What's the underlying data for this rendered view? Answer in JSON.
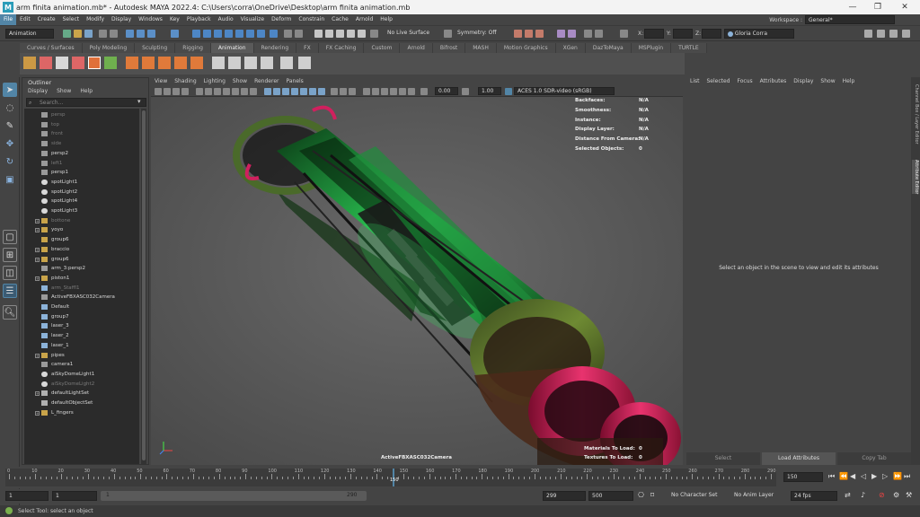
{
  "window": {
    "title": "arm finita animation.mb* - Autodesk MAYA 2022.4: C:\\Users\\corra\\OneDrive\\Desktop\\arm finita animation.mb",
    "logo": "M",
    "minimize": "—",
    "maximize": "❐",
    "close": "✕"
  },
  "menu": [
    "File",
    "Edit",
    "Create",
    "Select",
    "Modify",
    "Display",
    "Windows",
    "Key",
    "Playback",
    "Audio",
    "Visualize",
    "Deform",
    "Constrain",
    "Cache",
    "Arnold",
    "Help"
  ],
  "workspace": {
    "label": "Workspace :",
    "value": "General*"
  },
  "statusline": {
    "menuset": "Animation",
    "live_surface": "No Live Surface",
    "symmetry": "Symmetry: Off",
    "x_label": "X:",
    "y_label": "Y:",
    "z_label": "Z:",
    "user": "Gloria Corra"
  },
  "shelf_tabs": [
    "Curves / Surfaces",
    "Poly Modeling",
    "Sculpting",
    "Rigging",
    "Animation",
    "Rendering",
    "FX",
    "FX Caching",
    "Custom",
    "Arnold",
    "Bifrost",
    "MASH",
    "Motion Graphics",
    "XGen",
    "DazToMaya",
    "MSPlugin",
    "TURTLE"
  ],
  "shelf_active": "Animation",
  "outliner": {
    "title": "Outliner",
    "menu": [
      "Display",
      "Show",
      "Help"
    ],
    "search_placeholder": "Search...",
    "items": [
      {
        "label": "persp",
        "type": "camera",
        "dim": true,
        "exp": false
      },
      {
        "label": "top",
        "type": "camera",
        "dim": true,
        "exp": false
      },
      {
        "label": "front",
        "type": "camera",
        "dim": true,
        "exp": false
      },
      {
        "label": "side",
        "type": "camera",
        "dim": true,
        "exp": false
      },
      {
        "label": "persp2",
        "type": "camera",
        "dim": false,
        "exp": false
      },
      {
        "label": "left1",
        "type": "camera",
        "dim": true,
        "exp": false
      },
      {
        "label": "persp1",
        "type": "camera",
        "dim": false,
        "exp": false
      },
      {
        "label": "spotLight1",
        "type": "light",
        "dim": false,
        "exp": false
      },
      {
        "label": "spotLight2",
        "type": "light",
        "dim": false,
        "exp": false
      },
      {
        "label": "spotLight4",
        "type": "light",
        "dim": false,
        "exp": false
      },
      {
        "label": "spotLight3",
        "type": "light",
        "dim": false,
        "exp": false
      },
      {
        "label": "bottone",
        "type": "group",
        "dim": true,
        "exp": true
      },
      {
        "label": "yoyo",
        "type": "group",
        "dim": false,
        "exp": true
      },
      {
        "label": "group6",
        "type": "group",
        "dim": false,
        "exp": false
      },
      {
        "label": "braccio",
        "type": "group",
        "dim": false,
        "exp": true
      },
      {
        "label": "group6",
        "type": "group",
        "dim": false,
        "exp": true
      },
      {
        "label": "arm_3:persp2",
        "type": "camera",
        "dim": false,
        "exp": false
      },
      {
        "label": "piston1",
        "type": "group",
        "dim": false,
        "exp": true
      },
      {
        "label": "arm_Staffl1",
        "type": "mesh",
        "dim": true,
        "exp": false
      },
      {
        "label": "ActiveFBXASC032Camera",
        "type": "camera",
        "dim": false,
        "exp": false
      },
      {
        "label": "Default",
        "type": "mesh",
        "dim": false,
        "exp": false
      },
      {
        "label": "group7",
        "type": "mesh",
        "dim": false,
        "exp": false
      },
      {
        "label": "laser_3",
        "type": "mesh",
        "dim": false,
        "exp": false
      },
      {
        "label": "laser_2",
        "type": "mesh",
        "dim": false,
        "exp": false
      },
      {
        "label": "laser_1",
        "type": "mesh",
        "dim": false,
        "exp": false
      },
      {
        "label": "pipes",
        "type": "group",
        "dim": false,
        "exp": true
      },
      {
        "label": "camera1",
        "type": "camera",
        "dim": false,
        "exp": false
      },
      {
        "label": "aiSkyDomeLight1",
        "type": "dome",
        "dim": false,
        "exp": false
      },
      {
        "label": "aiSkyDomeLight2",
        "type": "dome",
        "dim": true,
        "exp": false
      },
      {
        "label": "defaultLightSet",
        "type": "set",
        "dim": false,
        "exp": true
      },
      {
        "label": "defaultObjectSet",
        "type": "set",
        "dim": false,
        "exp": false
      },
      {
        "label": "L_fingers",
        "type": "group",
        "dim": false,
        "exp": true
      }
    ]
  },
  "viewport": {
    "menu": [
      "View",
      "Shading",
      "Lighting",
      "Show",
      "Renderer",
      "Panels"
    ],
    "exposure": "0.00",
    "gamma": "1.00",
    "colorspace": "ACES 1.0 SDR-video (sRGB)",
    "hud": [
      {
        "label": "Backfaces:",
        "value": "N/A"
      },
      {
        "label": "Smoothness:",
        "value": "N/A"
      },
      {
        "label": "Instance:",
        "value": "N/A"
      },
      {
        "label": "Display Layer:",
        "value": "N/A"
      },
      {
        "label": "Distance From Camera:",
        "value": "N/A"
      },
      {
        "label": "Selected Objects:",
        "value": "0"
      }
    ],
    "materials_label": "Materials To Load:",
    "materials_value": "0",
    "textures_label": "Textures To Load:",
    "textures_value": "0",
    "camera_name": "ActiveFBXASC032Camera"
  },
  "attribute_editor": {
    "menu": [
      "List",
      "Selected",
      "Focus",
      "Attributes",
      "Display",
      "Show",
      "Help"
    ],
    "message": "Select an object in the scene to view and edit its attributes",
    "buttons": [
      "Select",
      "Load Attributes",
      "Copy Tab"
    ],
    "side_tabs": [
      "Channel Box / Layer Editor",
      "Attribute Editor"
    ]
  },
  "timeline": {
    "ticks": [
      "10",
      "20",
      "30",
      "40",
      "50",
      "60",
      "70",
      "80",
      "90",
      "100",
      "110",
      "120",
      "130",
      "140",
      "150",
      "160",
      "170",
      "180",
      "190",
      "200",
      "210",
      "220",
      "230",
      "240",
      "250",
      "260",
      "270",
      "280",
      "290"
    ],
    "start_label": "0",
    "current_marker": "150",
    "current_frame": "150"
  },
  "range": {
    "start": "1",
    "playback_start": "1",
    "slider_start": "1",
    "slider_end": "290",
    "playback_end": "299",
    "end": "500",
    "character_set": "No Character Set",
    "anim_layer": "No Anim Layer",
    "fps": "24 fps"
  },
  "help_line": "Select Tool: select an object",
  "colors": {
    "accent": "#5285a6",
    "green": "#2fd65a",
    "magenta": "#d0205e"
  }
}
